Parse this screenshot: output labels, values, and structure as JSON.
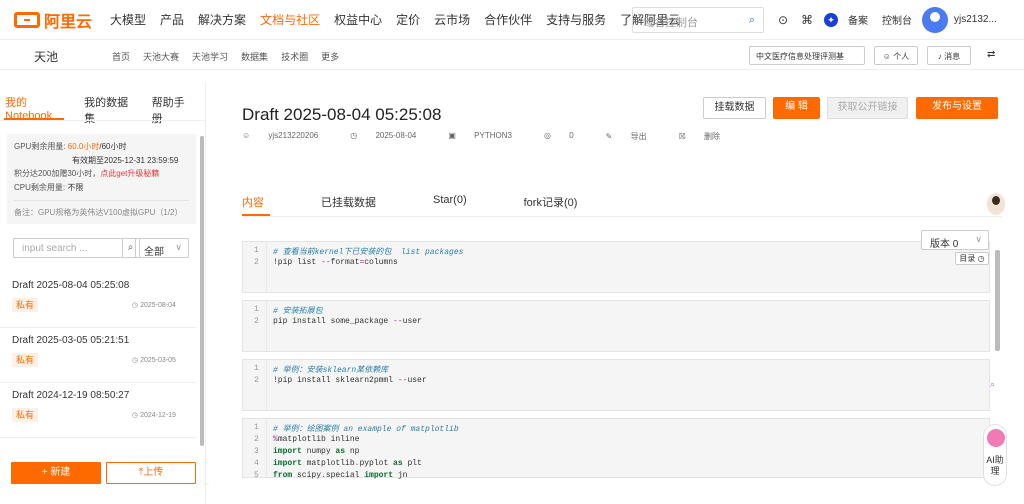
{
  "topbar": {
    "logo_text": "阿里云",
    "nav": [
      "大模型",
      "产品",
      "解决方案",
      "文档与社区",
      "权益中心",
      "定价",
      "云市场",
      "合作伙伴",
      "支持与服务",
      "了解阿里云"
    ],
    "nav_active_index": 3,
    "search_placeholder": "域名控制台",
    "filing": "备案",
    "console": "控制台",
    "username": "yjs2132..."
  },
  "subbar": {
    "title": "天池",
    "links": [
      "首页",
      "天池大赛",
      "天池学习",
      "数据集",
      "技术圈",
      "更多"
    ],
    "search_value": "中文医疗信息处理评测基",
    "personal": "个人",
    "messages": "消息"
  },
  "sidebar": {
    "tabs": [
      "我的Notebook",
      "我的数据集",
      "帮助手册"
    ],
    "gpu_label": "GPU剩余用量:",
    "gpu_value": "60.0小时",
    "gpu_total": "/60小时",
    "gpu_expiry": "有效期至2025-12-31 23:59:59",
    "points_text": "积分达200加赠30小时，",
    "points_link": "点此get升级秘籍",
    "cpu_label": "CPU剩余用量:",
    "cpu_value": "不限",
    "note": "备注：GPU规格为英伟达V100虚拟GPU（1/2）",
    "search_placeholder": "input search ...",
    "filter": "全部",
    "items": [
      {
        "title": "Draft 2025-08-04 05:25:08",
        "badge": "私有",
        "date": "2025-08-04"
      },
      {
        "title": "Draft 2025-03-05 05:21:51",
        "badge": "私有",
        "date": "2025-03-05"
      },
      {
        "title": "Draft 2024-12-19 08:50:27",
        "badge": "私有",
        "date": "2024-12-19"
      }
    ],
    "new_button": "新建",
    "upload_button": "上传"
  },
  "main": {
    "title": "Draft 2025-08-04 05:25:08",
    "meta": {
      "author": "yjs213220206",
      "date": "2025-08-04",
      "kernel": "PYTHON3",
      "views": "0",
      "export": "导出",
      "delete": "删除"
    },
    "buttons": {
      "mount": "挂载数据",
      "edit": "编 辑",
      "public_link": "获取公开链接",
      "publish": "发布与设置"
    },
    "tabs": [
      "内容",
      "已挂载数据",
      "Star(0)",
      "fork记录(0)"
    ],
    "version": "版本 0",
    "toc": "目录",
    "cells": [
      {
        "lines": [
          [
            {
              "t": "# 查看当前kernel下已安装的包  list packages",
              "c": "cm"
            }
          ],
          [
            {
              "t": "!pip list ",
              "c": ""
            },
            {
              "t": "--",
              "c": "op"
            },
            {
              "t": "format",
              "c": ""
            },
            {
              "t": "=",
              "c": "op"
            },
            {
              "t": "columns",
              "c": ""
            }
          ]
        ]
      },
      {
        "lines": [
          [
            {
              "t": "# 安装拓展包",
              "c": "cm"
            }
          ],
          [
            {
              "t": "pip install some_package ",
              "c": ""
            },
            {
              "t": "--",
              "c": "op"
            },
            {
              "t": "user",
              "c": ""
            }
          ]
        ]
      },
      {
        "lines": [
          [
            {
              "t": "# 举例：安装sklearn某依赖库",
              "c": "cm"
            }
          ],
          [
            {
              "t": "!pip install sklearn2pmml ",
              "c": ""
            },
            {
              "t": "--",
              "c": "op"
            },
            {
              "t": "user",
              "c": ""
            }
          ]
        ]
      },
      {
        "lines": [
          [
            {
              "t": "# 举例：绘图案例 an example of matplotlib",
              "c": "cm"
            }
          ],
          [
            {
              "t": "%",
              "c": "op"
            },
            {
              "t": "matplotlib inline",
              "c": ""
            }
          ],
          [
            {
              "t": "import",
              "c": "kw"
            },
            {
              "t": " numpy ",
              "c": ""
            },
            {
              "t": "as",
              "c": "kw"
            },
            {
              "t": " np",
              "c": ""
            }
          ],
          [
            {
              "t": "import",
              "c": "kw"
            },
            {
              "t": " matplotlib",
              "c": ""
            },
            {
              "t": ".",
              "c": "op"
            },
            {
              "t": "pyplot ",
              "c": ""
            },
            {
              "t": "as",
              "c": "kw"
            },
            {
              "t": " plt",
              "c": ""
            }
          ],
          [
            {
              "t": "from",
              "c": "kw"
            },
            {
              "t": " scipy",
              "c": ""
            },
            {
              "t": ".",
              "c": "op"
            },
            {
              "t": "special ",
              "c": ""
            },
            {
              "t": "import",
              "c": "kw"
            },
            {
              "t": " jn",
              "c": ""
            }
          ]
        ]
      }
    ],
    "ai_help": "AI助理"
  },
  "colors": {
    "accent": "#ff6a00",
    "link_blue": "#1a66d6"
  }
}
